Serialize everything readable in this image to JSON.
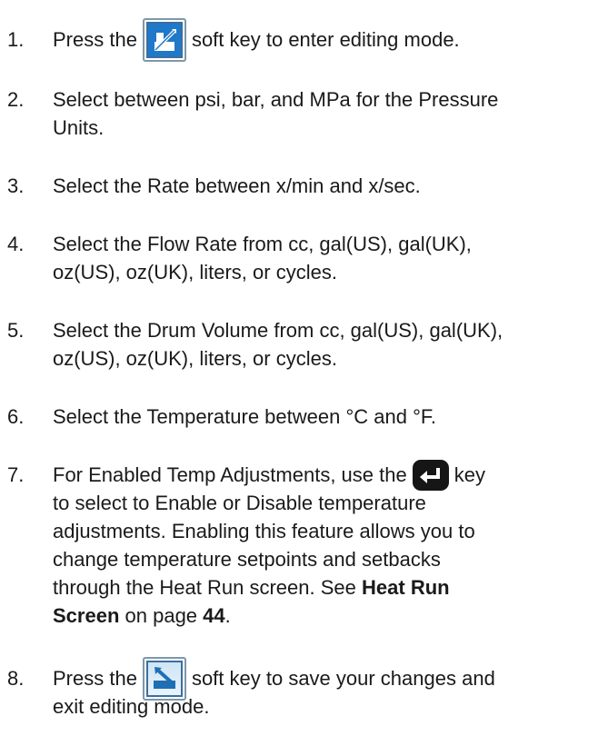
{
  "steps": [
    {
      "number": "1.",
      "before": "Press the",
      "icon": "edit-softkey-icon",
      "after": "soft key to enter editing mode."
    },
    {
      "number": "2.",
      "line1": "Select between psi, bar, and MPa for the Pressure",
      "line2": "Units."
    },
    {
      "number": "3.",
      "line1": "Select the Rate between x/min and x/sec."
    },
    {
      "number": "4.",
      "line1": "Select the Flow Rate from cc, gal(US), gal(UK),",
      "line2": "oz(US), oz(UK), liters, or cycles."
    },
    {
      "number": "5.",
      "line1": "Select the Drum Volume from cc, gal(US), gal(UK),",
      "line2": "oz(US), oz(UK), liters, or cycles."
    },
    {
      "number": "6.",
      "line1": "Select the Temperature between °C and °F."
    },
    {
      "number": "7.",
      "before": "For Enabled Temp Adjustments, use the",
      "icon": "enter-key-icon",
      "after": "key",
      "line2": "to select to Enable or Disable temperature",
      "line3": "adjustments. Enabling this feature allows you to",
      "line4": "change temperature setpoints and setbacks",
      "line5_before": "through the Heat Run screen. See",
      "link_part1": "Heat Run",
      "link_part2": "Screen",
      "line6_mid": "on page",
      "page_ref": "44",
      "line6_end": "."
    },
    {
      "number": "8.",
      "before": "Press the",
      "icon": "save-exit-softkey-icon",
      "after": "soft key to save your changes and",
      "line2": "exit editing mode."
    }
  ],
  "colors": {
    "text": "#1a1a1a",
    "edit_key_fill": "#1f78c8",
    "save_key_fill": "#dcebf7",
    "enter_key_fill": "#161616"
  }
}
